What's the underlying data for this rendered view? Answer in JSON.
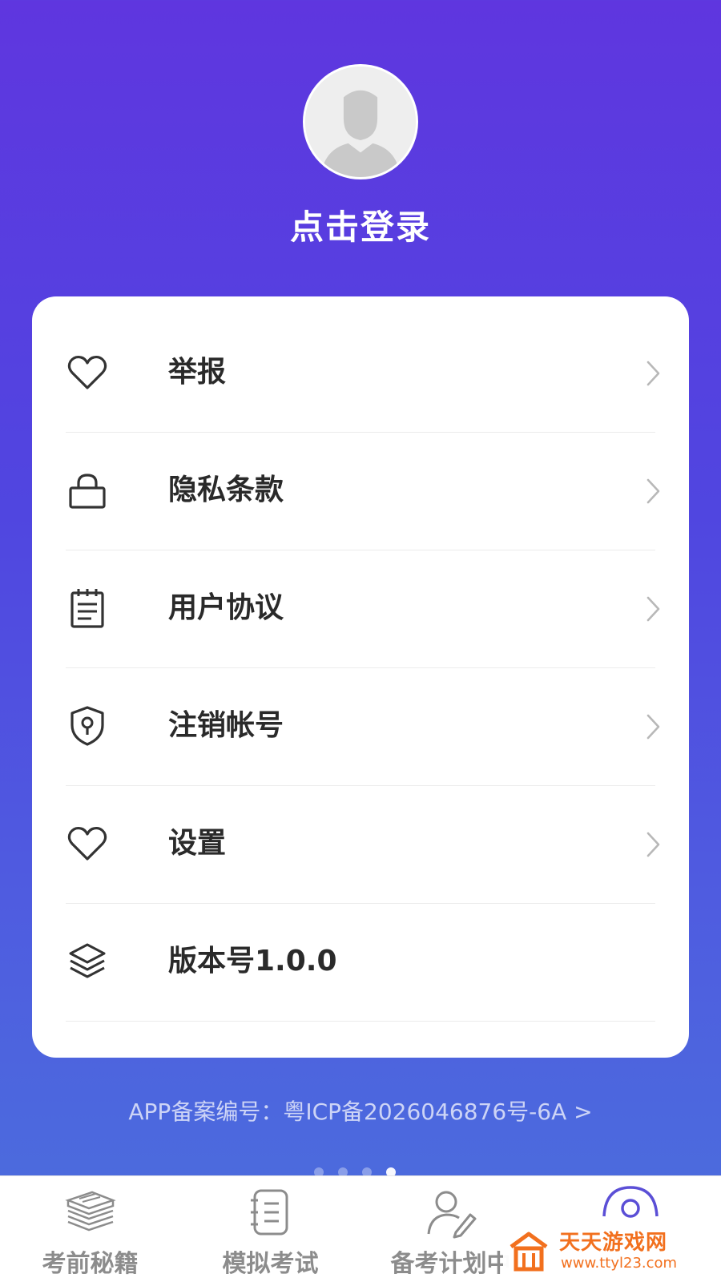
{
  "profile": {
    "login_label": "点击登录"
  },
  "menu": {
    "items": [
      {
        "label": "举报",
        "icon": "heart-icon"
      },
      {
        "label": "隐私条款",
        "icon": "lock-icon"
      },
      {
        "label": "用户协议",
        "icon": "notepad-icon"
      },
      {
        "label": "注销帐号",
        "icon": "shield-keyhole-icon"
      },
      {
        "label": "设置",
        "icon": "heart-icon"
      },
      {
        "label": "版本号1.0.0",
        "icon": "layers-icon"
      }
    ]
  },
  "footer": {
    "icp_text": "APP备案编号：粤ICP备2026046876号-6A >"
  },
  "pager": {
    "count": 4,
    "active_index": 3
  },
  "tabbar": {
    "tabs": [
      {
        "label": "考前秘籍",
        "icon": "books-icon"
      },
      {
        "label": "模拟考试",
        "icon": "notebook-icon"
      },
      {
        "label": "备考计划中",
        "icon": "user-pen-icon"
      },
      {
        "label": "",
        "icon": "user-circle-icon"
      }
    ]
  },
  "watermark": {
    "name": "天天游戏网",
    "url": "www.ttyl23.com"
  },
  "colors": {
    "gradient_top": "#5f36df",
    "gradient_bottom": "#4a70dc",
    "card_bg": "#ffffff",
    "label_text": "#2a2a2a",
    "tab_inactive": "#8c8c8c",
    "tab_active": "#5b4fd6",
    "watermark": "#f2701e"
  }
}
